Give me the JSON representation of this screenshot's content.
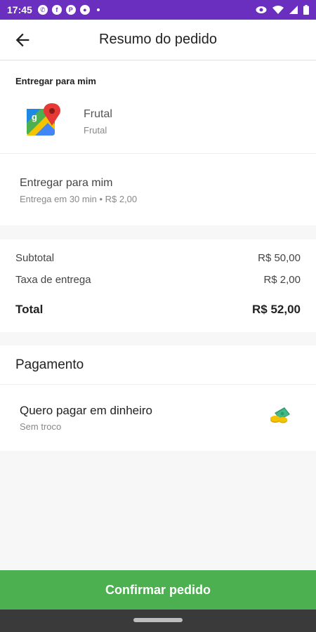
{
  "status_bar": {
    "time": "17:45",
    "notification_icons": [
      "whatsapp-icon",
      "facebook-icon",
      "pinterest-icon",
      "app-icon",
      "dot-icon"
    ],
    "system_icons": [
      "eye-icon",
      "wifi-icon",
      "signal-icon",
      "battery-icon"
    ],
    "color": "#6b2fbf"
  },
  "header": {
    "title": "Resumo do pedido"
  },
  "delivery": {
    "section_label": "Entregar para mim",
    "address_name": "Frutal",
    "address_city": "Frutal",
    "option_title": "Entregar para mim",
    "option_detail": "Entrega em 30 min • R$ 2,00"
  },
  "summary": {
    "subtotal_label": "Subtotal",
    "subtotal_value": "R$ 50,00",
    "fee_label": "Taxa de entrega",
    "fee_value": "R$ 2,00",
    "total_label": "Total",
    "total_value": "R$ 52,00"
  },
  "payment": {
    "title": "Pagamento",
    "method": "Quero pagar em dinheiro",
    "method_detail": "Sem troco"
  },
  "footer": {
    "confirm_label": "Confirmar pedido",
    "accent": "#4caf50"
  }
}
